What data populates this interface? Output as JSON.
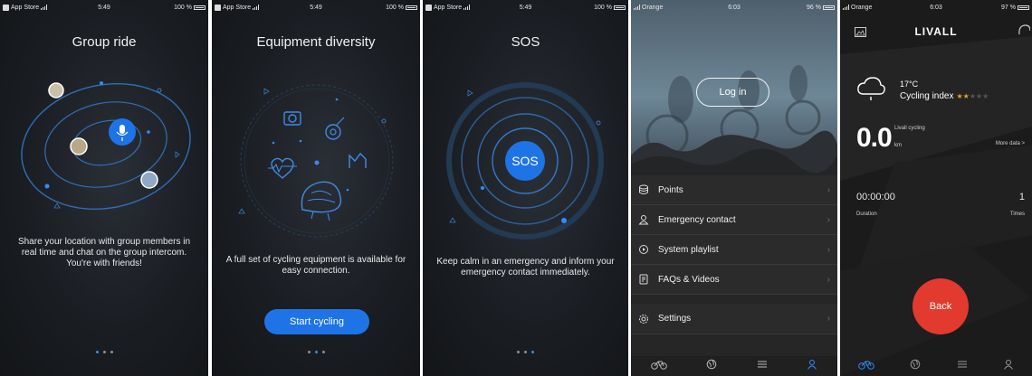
{
  "status_intro": {
    "carrier": "App Store",
    "time": "5:49",
    "battery": "100 %"
  },
  "intro1": {
    "title": "Group ride",
    "description": "Share your location with group members in real time and chat on the group intercom. You're with friends!"
  },
  "intro2": {
    "title": "Equipment diversity",
    "description": "A full set of cycling equipment is available for easy connection.",
    "button": "Start cycling"
  },
  "intro3": {
    "title": "SOS",
    "sos_label": "SOS",
    "description": "Keep calm in an emergency and inform your emergency contact immediately."
  },
  "profile": {
    "status": {
      "carrier": "Orange",
      "time": "6:03",
      "battery": "96 %"
    },
    "login_label": "Log in",
    "menu": [
      {
        "label": "Points",
        "icon": "database-icon"
      },
      {
        "label": "Emergency contact",
        "icon": "contact-icon"
      },
      {
        "label": "System playlist",
        "icon": "playlist-icon"
      },
      {
        "label": "FAQs & Videos",
        "icon": "faq-icon"
      }
    ],
    "settings_label": "Settings"
  },
  "dashboard": {
    "status": {
      "carrier": "Orange",
      "time": "6:03",
      "battery": "97 %"
    },
    "brand": "LIVALL",
    "temperature": "17°C",
    "cycling_index_label": "Cycling index",
    "cycling_index_stars": 2,
    "distance_value": "0.0",
    "distance_label": "Livall cycling",
    "distance_unit": "km",
    "more_data": "More data >",
    "duration_value": "00:00:00",
    "duration_label": "Duration",
    "times_value": "1",
    "times_label": "Times",
    "back_label": "Back"
  },
  "colors": {
    "accent": "#1e74e6",
    "active_dot": "#2f8cff",
    "danger": "#e23a2e",
    "star": "#e5a31f"
  }
}
